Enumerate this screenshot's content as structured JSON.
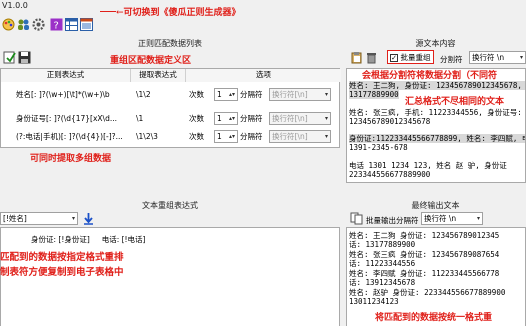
{
  "app": {
    "title": "V1.0.0"
  },
  "annotations": {
    "top": "←可切换到《傻瓜正则生成器》",
    "group_def": "重组区配数据定义区",
    "multi_extract": "可同时提取多组数据",
    "batch_split": "会根据分割符将数据分割（不同符",
    "summary_fmt": "汇总格式不尽相同的文本",
    "format_desc1": "匹配到的数据按指定格式重排",
    "format_desc2": "制表符方便复制到电子表格中",
    "output_desc": "将匹配到的数据按统一格式重"
  },
  "left_top": {
    "title": "正则匹配数据列表",
    "columns": [
      "正则表达式",
      "提取表达式",
      "选项"
    ],
    "rows": [
      {
        "regex": "姓名[: ]?(\\w+)[\\t]*(\\w+)\\b",
        "extract": "\\1\\2",
        "times_label": "次数",
        "times": "1",
        "split_label": "分隔符",
        "split_value": "换行符[\\n]"
      },
      {
        "regex": "身份证号[: ]?(\\d{17}[xX\\d...",
        "extract": "\\1",
        "times_label": "次数",
        "times": "1",
        "split_label": "分隔符",
        "split_value": "换行符[\\n]"
      },
      {
        "regex": "(?:电话|手机)[: ]?(\\d{4})[-]?...",
        "extract": "\\1\\2\\3",
        "times_label": "次数",
        "times": "1",
        "split_label": "分隔符",
        "split_value": "换行符[\\n]"
      }
    ]
  },
  "left_bottom": {
    "title": "文本重组表达式",
    "combo_value": "[!姓名]",
    "template_text": "身份证: [!身份证]     电话: [!电话]"
  },
  "right_top": {
    "title": "源文本内容",
    "batch_label": "批量重组",
    "sep_label": "分割符",
    "sep_value": "换行符 \\n",
    "lines": [
      "姓名: 王二狗, 身份证: 123456789012345678, 电话:",
      "13177889900",
      "",
      "姓名: 张三疯, 手机: 11223344556, 身份证号:",
      "123456789012345678",
      "",
      "身份证:112233445566778899, 姓名: 李四赋, 电",
      "1391-2345-678",
      "",
      "电话 1301 1234 123, 姓名 赵 驴, 身份证",
      "223344556677889900"
    ]
  },
  "right_bottom": {
    "title": "最终输出文本",
    "sep_label": "批量输出分隔符",
    "sep_value": "换行符 \\n",
    "lines": [
      "姓名: 王二狗          身份证: 123456789012345",
      "话: 13177889900",
      "姓名: 张三疯          身份证: 123456789087654",
      "话: 11223344556",
      "姓名: 李四赋          身份证: 112233445566778",
      "话: 13912345678",
      "姓名: 赵驴 身份证: 223344556677889900",
      "13011234123"
    ]
  },
  "colors": {
    "accent": "#e0201a",
    "highlight": "#0a64c8"
  }
}
